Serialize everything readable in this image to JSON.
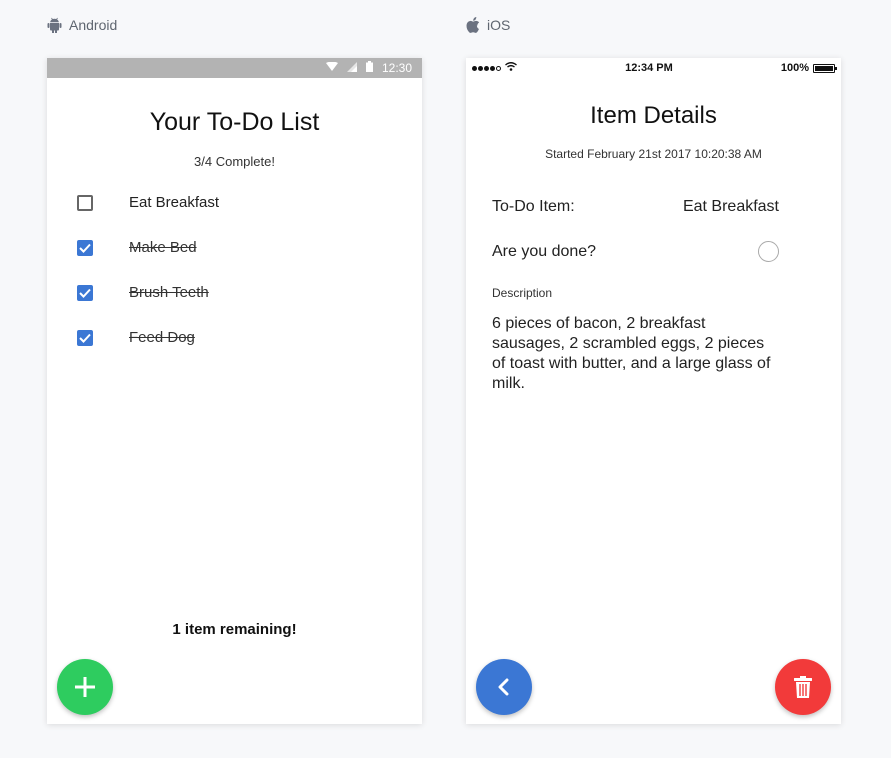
{
  "labels": {
    "android": "Android",
    "ios": "iOS"
  },
  "android": {
    "status_time": "12:30",
    "title": "Your To-Do List",
    "progress": "3/4 Complete!",
    "items": [
      {
        "label": "Eat Breakfast",
        "done": false
      },
      {
        "label": "Make Bed",
        "done": true
      },
      {
        "label": "Brush Teeth",
        "done": true
      },
      {
        "label": "Feed Dog",
        "done": true
      }
    ],
    "remaining": "1 item remaining!"
  },
  "ios": {
    "status_time": "12:34 PM",
    "battery": "100%",
    "title": "Item Details",
    "started": "Started February 21st 2017 10:20:38 AM",
    "todo_item_label": "To-Do Item:",
    "todo_item_value": "Eat Breakfast",
    "done_label": "Are you done?",
    "description_label": "Description",
    "description_text": "6 pieces of bacon, 2 breakfast sausages, 2 scrambled eggs, 2 pieces of toast with butter, and a large glass of milk."
  },
  "colors": {
    "check_blue": "#3b77d4",
    "fab_green": "#2ecc5f",
    "fab_blue": "#3b77d4",
    "fab_red": "#f23a3a"
  },
  "icons": {
    "android_label": "android-icon",
    "ios_label": "apple-icon",
    "add": "plus-icon",
    "back": "chevron-left-icon",
    "delete": "trash-icon"
  }
}
